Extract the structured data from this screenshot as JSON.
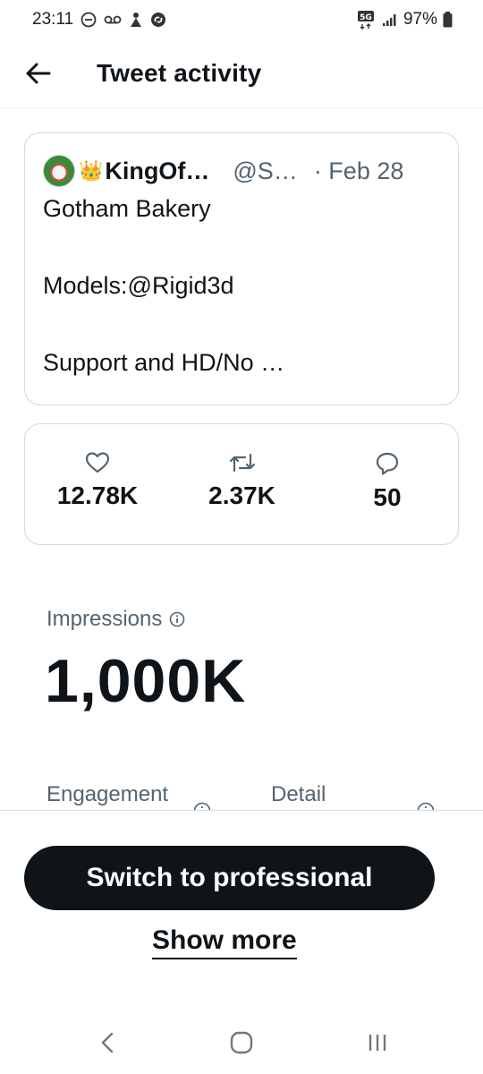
{
  "status_bar": {
    "time": "23:11",
    "network": "5G",
    "battery": "97%"
  },
  "header": {
    "title": "Tweet activity"
  },
  "tweet": {
    "display_name": "KingOf…",
    "handle": "@S…",
    "date": "· Feb 28",
    "text": "Gotham Bakery\n\nModels:@Rigid3d\n\nSupport and HD/No …"
  },
  "stats": {
    "likes": "12.78K",
    "retweets": "2.37K",
    "replies": "50"
  },
  "impressions": {
    "label": "Impressions",
    "value": "1,000K"
  },
  "metrics": {
    "engagement_label": "Engagement",
    "detail_label": "Detail"
  },
  "actions": {
    "switch_professional": "Switch to professional",
    "show_more": "Show more"
  },
  "icons": {
    "back": "arrow-left-icon",
    "like": "heart-icon",
    "retweet": "retweet-icon",
    "reply": "reply-icon",
    "info": "info-icon"
  }
}
